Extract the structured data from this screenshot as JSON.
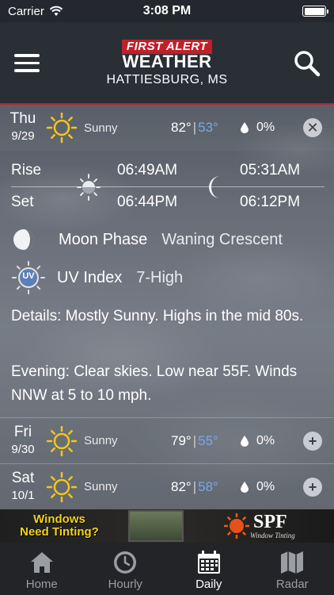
{
  "status_bar": {
    "carrier": "Carrier",
    "time": "3:08 PM"
  },
  "header": {
    "logo_top": "FIRST ALERT",
    "logo_bottom": "WEATHER",
    "city": "HATTIESBURG, MS"
  },
  "days": [
    {
      "name": "Thu",
      "date": "9/29",
      "condition": "Sunny",
      "high": "82°",
      "separator": "|",
      "low": "53°",
      "precip": "0%",
      "expanded": true
    },
    {
      "name": "Fri",
      "date": "9/30",
      "condition": "Sunny",
      "high": "79°",
      "separator": "|",
      "low": "55°",
      "precip": "0%",
      "expanded": false
    },
    {
      "name": "Sat",
      "date": "10/1",
      "condition": "Sunny",
      "high": "82°",
      "separator": "|",
      "low": "58°",
      "precip": "0%",
      "expanded": false
    }
  ],
  "details": {
    "rise_label": "Rise",
    "set_label": "Set",
    "sunrise": "06:49AM",
    "sunset": "06:44PM",
    "moonrise": "05:31AM",
    "moonset": "06:12PM",
    "moon_phase_label": "Moon Phase",
    "moon_phase_value": "Waning Crescent",
    "uv_label": "UV Index",
    "uv_value": "7-High",
    "uv_icon_text": "UV",
    "details_text": "Details: Mostly Sunny. Highs  in the mid 80s.",
    "evening_text": "Evening: Clear skies. Low near 55F. Winds NNW at 5 to 10 mph."
  },
  "collapse_icon": "✕",
  "expand_icon": "+",
  "ad": {
    "line1": "Windows",
    "line2": "Need Tinting?",
    "brand": "SPF",
    "tagline": "Window Tinting"
  },
  "tabs": [
    {
      "label": "Home",
      "icon": "home-icon",
      "active": false
    },
    {
      "label": "Hourly",
      "icon": "clock-icon",
      "active": false
    },
    {
      "label": "Daily",
      "icon": "calendar-icon",
      "active": true
    },
    {
      "label": "Radar",
      "icon": "map-icon",
      "active": false
    }
  ],
  "colors": {
    "accent_red": "#c0202a",
    "low_temp": "#7aa7e6",
    "sun": "#f5c518",
    "ad_yellow": "#f4d21a"
  }
}
